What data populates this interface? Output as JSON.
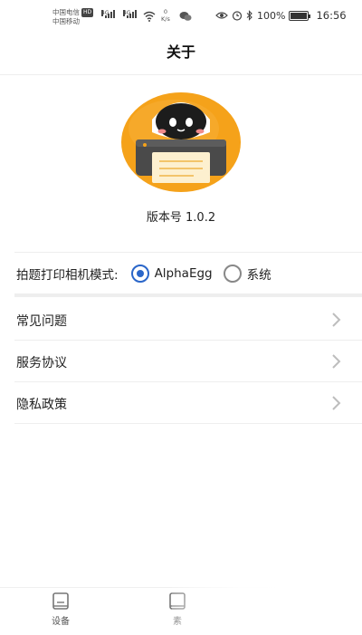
{
  "status_bar": {
    "carrier1": "中国电信",
    "hd_badge": "HD",
    "carrier2": "中国移动",
    "net1": "4G",
    "net2": "4G",
    "speed_value": "0",
    "speed_unit": "K/s",
    "battery_percent": "100%",
    "time": "16:56"
  },
  "header": {
    "title": "关于"
  },
  "app": {
    "version": "版本号 1.0.2"
  },
  "mode": {
    "label": "拍题打印相机模式:",
    "options": [
      {
        "label": "AlphaEgg",
        "selected": true
      },
      {
        "label": "系统",
        "selected": false
      }
    ]
  },
  "menu": {
    "items": [
      {
        "label": "常见问题"
      },
      {
        "label": "服务协议"
      },
      {
        "label": "隐私政策"
      }
    ]
  },
  "bottom_nav": {
    "tabs": [
      {
        "label": "设备",
        "icon": "device-icon"
      },
      {
        "label": "素",
        "icon": "material-icon"
      }
    ]
  },
  "colors": {
    "accent": "#2a66c9",
    "logo_orange": "#f5a21a",
    "divider": "#eeeeee"
  }
}
